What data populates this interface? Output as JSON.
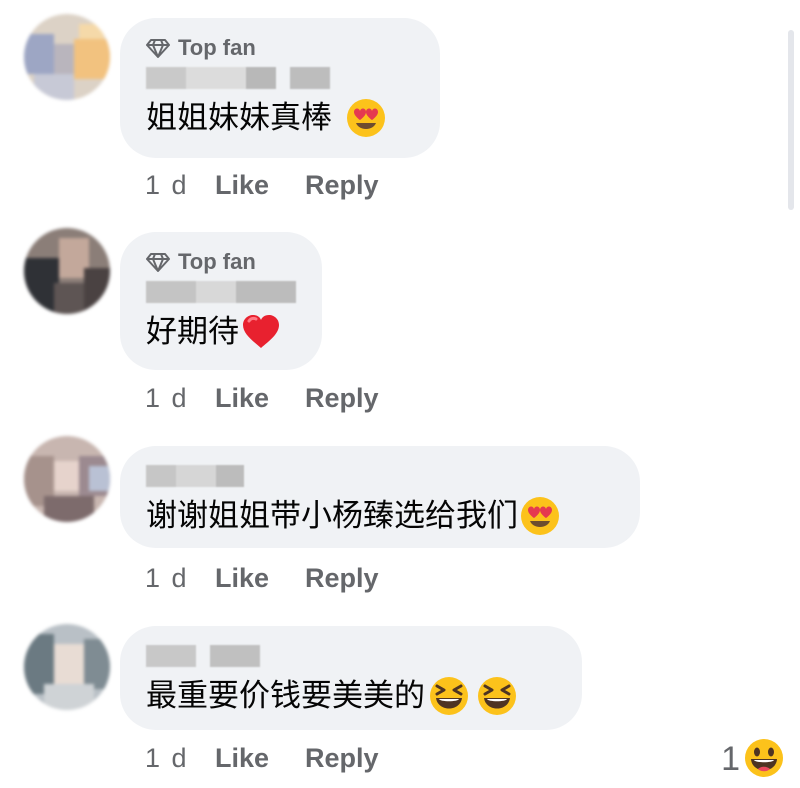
{
  "comments": [
    {
      "badge": "Top fan",
      "text": "姐姐妹妹真棒",
      "emoji": "heart-eyes-emoji",
      "time": "1 d",
      "like": "Like",
      "reply": "Reply"
    },
    {
      "badge": "Top fan",
      "text": "好期待",
      "emoji": "red-heart-emoji",
      "time": "1 d",
      "like": "Like",
      "reply": "Reply"
    },
    {
      "badge": "",
      "text": "谢谢姐姐带小杨臻选给我们",
      "emoji": "heart-eyes-emoji",
      "time": "1 d",
      "like": "Like",
      "reply": "Reply"
    },
    {
      "badge": "",
      "text": "最重要价钱要美美的",
      "emoji": "grinning-squinting-emoji x2",
      "time": "1 d",
      "like": "Like",
      "reply": "Reply"
    }
  ],
  "reaction": {
    "count": "1",
    "emoji": "grinning-face-emoji"
  },
  "colors": {
    "bubble": "#f0f2f5",
    "text": "#050505",
    "secondary": "#65676b"
  }
}
